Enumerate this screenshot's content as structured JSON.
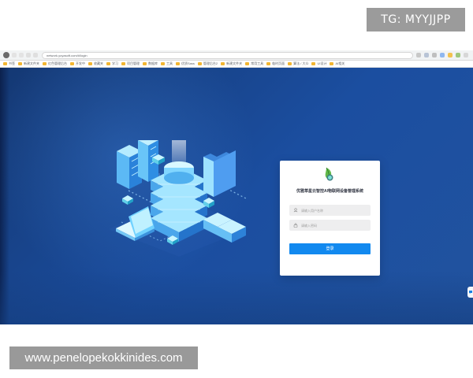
{
  "badges": {
    "top_right": "TG: MYYJJPP",
    "bottom_left": "www.penelopekokkinides.com"
  },
  "browser": {
    "url": "network.yoyasoft.com/#/login",
    "bookmarks": [
      "书签",
      "新建文件夹",
      "红色管理后台",
      "开发中",
      "收藏夹",
      "学习",
      "项目管理",
      "数据库",
      "工具",
      "优质Sass",
      "管理后台2",
      "新建文件夹",
      "常用工具",
      "临时页面",
      "算法 / 大众",
      "UI设计",
      "AI相关"
    ]
  },
  "login": {
    "title": "优雅草星云智控AI物联网设备管理系统",
    "username_placeholder": "请输入用户名称",
    "password_placeholder": "请输入密码",
    "button_label": "登录"
  },
  "icons": {
    "logo": "leaf-logo-icon",
    "user": "user-icon",
    "lock": "lock-icon",
    "browser_profile": "profile-avatar-icon",
    "side_widget": "chat-bubble-icon"
  },
  "colors": {
    "page_background": "#1f3a7a",
    "card_background": "#ffffff",
    "primary_button": "#1289ef",
    "field_background": "#eeeeef",
    "badge_gray": "#9b9b9b"
  }
}
